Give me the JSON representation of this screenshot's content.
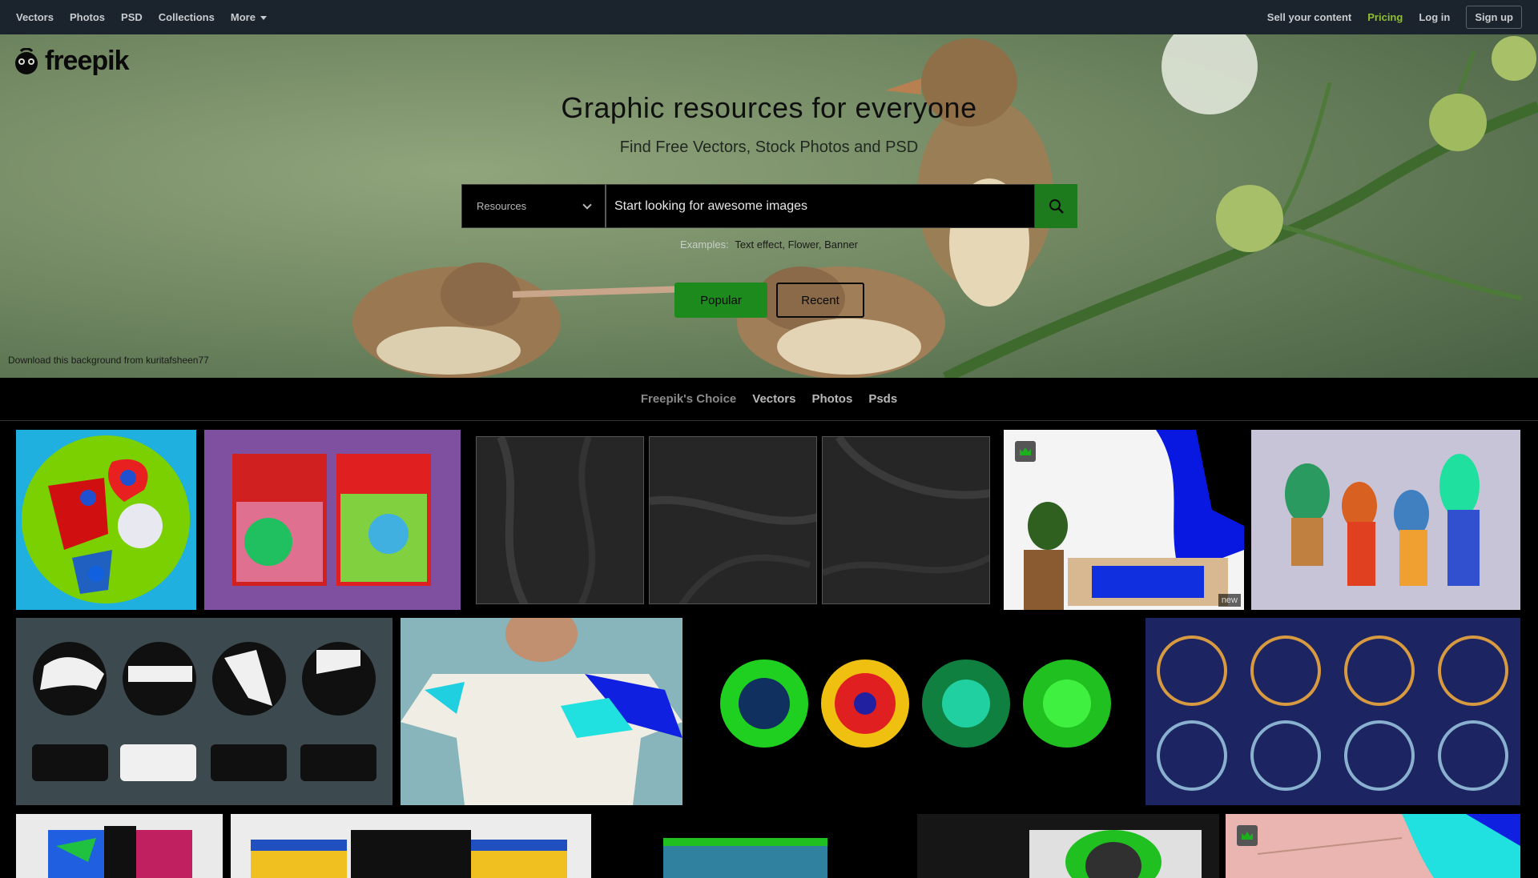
{
  "topnav": {
    "left": [
      "Vectors",
      "Photos",
      "PSD",
      "Collections",
      "More"
    ],
    "sell": "Sell your content",
    "pricing": "Pricing",
    "login": "Log in",
    "signup": "Sign up"
  },
  "hero": {
    "logo": "freepik",
    "title": "Graphic resources for everyone",
    "subtitle": "Find Free Vectors, Stock Photos and PSD",
    "search": {
      "select": "Resources",
      "placeholder": "Start looking for awesome images"
    },
    "examples_label": "Examples:",
    "examples": "Text effect, Flower, Banner",
    "popular": "Popular",
    "recent": "Recent",
    "credit": "Download this background from kuritafsheen77"
  },
  "tabs": [
    "Freepik's Choice",
    "Vectors",
    "Photos",
    "Psds"
  ],
  "grid": {
    "new_badge": "new"
  },
  "colors": {
    "nav_bg": "#1b242c",
    "accent": "#1d8a1d",
    "pricing": "#8fbf2c"
  }
}
